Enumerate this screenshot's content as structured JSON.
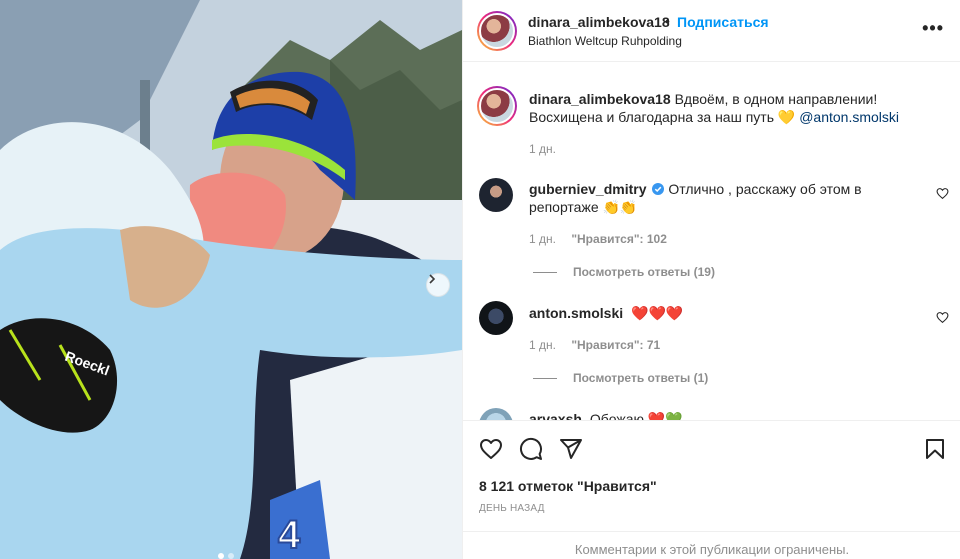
{
  "post": {
    "next_icon": "chevron-right-icon",
    "carousel": {
      "total": 2,
      "active": 1
    }
  },
  "header": {
    "username": "dinara_alimbekova18",
    "separator": "•",
    "follow_label": "Подписаться",
    "location": "Biathlon Weltcup Ruhpolding",
    "more_label": "•••"
  },
  "caption": {
    "username": "dinara_alimbekova18",
    "text": "Вдвоём, в одном направлении! Восхищена и благодарна за наш путь 💛",
    "mention": "@anton.smolski",
    "time": "1 дн."
  },
  "comments": [
    {
      "username": "guberniev_dmitry",
      "verified": true,
      "text": "Отлично , расскажу об этом в репортаже 👏👏",
      "time": "1 дн.",
      "likes": "\"Нравится\": 102",
      "replies": "Посмотреть ответы (19)"
    },
    {
      "username": "anton.smolski",
      "verified": false,
      "text": "❤️❤️❤️",
      "time": "1 дн.",
      "likes": "\"Нравится\": 71",
      "replies": "Посмотреть ответы (1)"
    },
    {
      "username": "arvaxsh",
      "text": "Обожаю ❤️💚"
    }
  ],
  "actions": {
    "likes_text": "8 121 отметок \"Нравится\"",
    "timestamp": "ДЕНЬ НАЗАД",
    "comments_limited": "Комментарии к этой публикации ограничены."
  },
  "colors": {
    "accent": "#0095f6",
    "text": "#262626",
    "secondary": "#8e8e8e",
    "verified": "#3897f0",
    "emoji_heart": "#e0245e"
  }
}
